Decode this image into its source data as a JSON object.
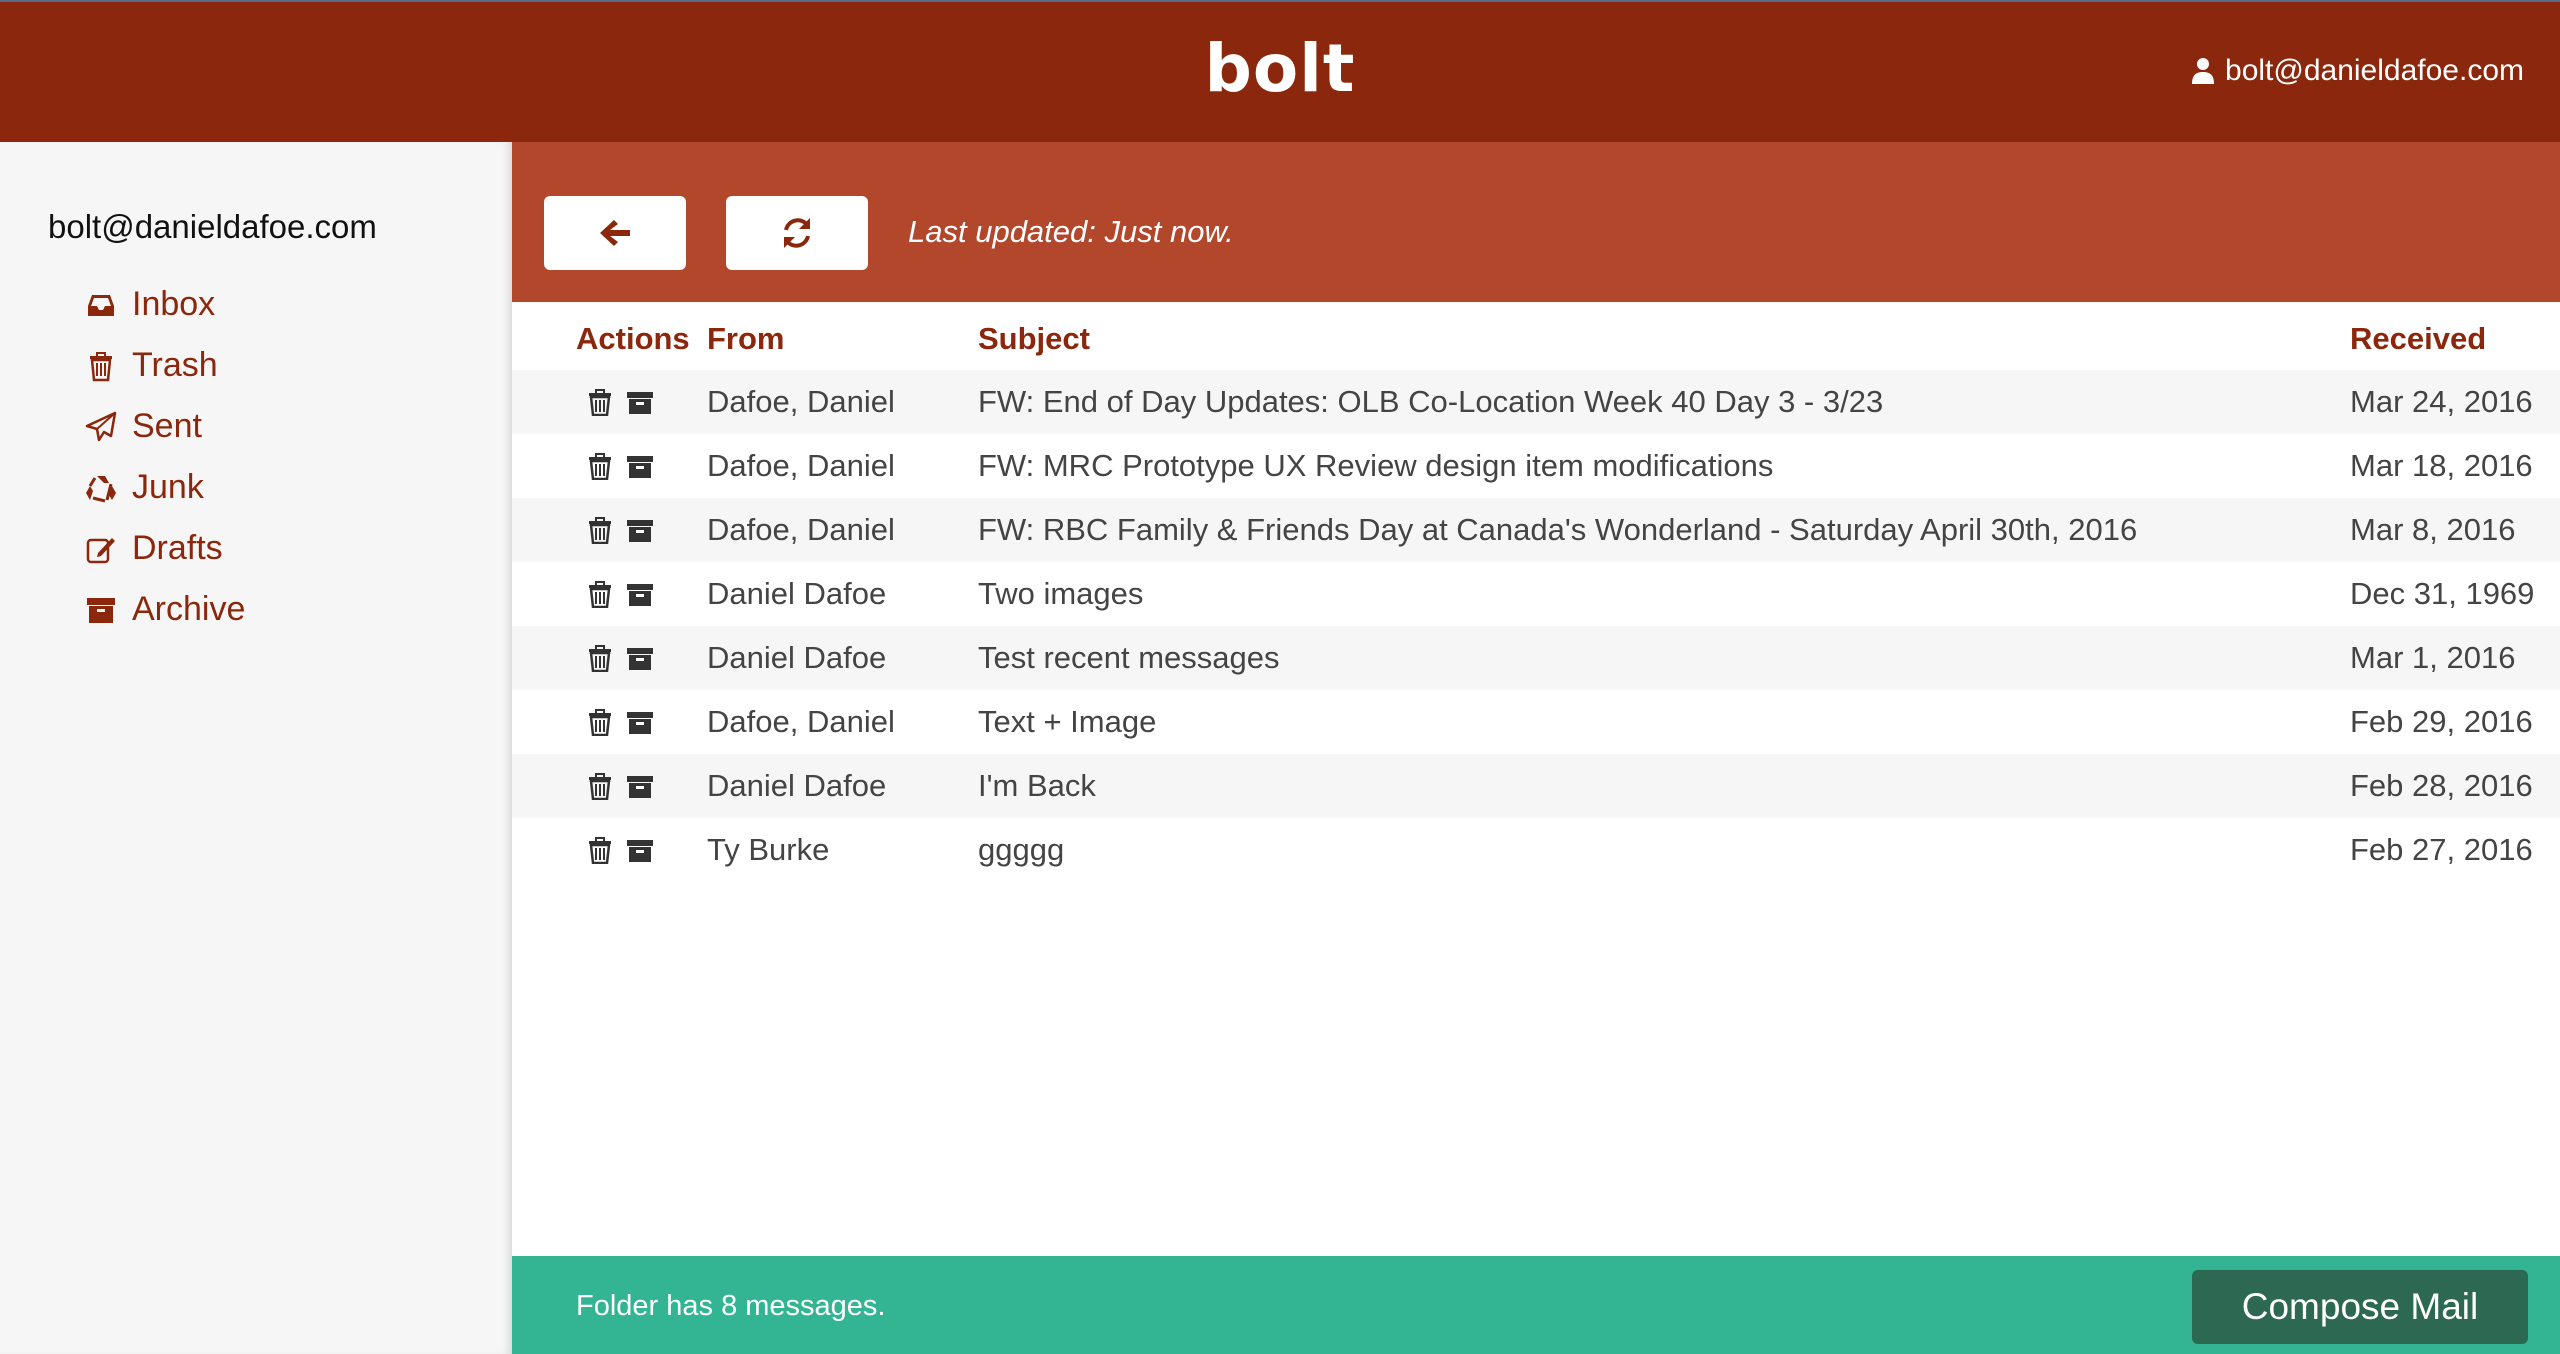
{
  "header": {
    "logo": "bolt",
    "user_email": "bolt@danieldafoe.com"
  },
  "sidebar": {
    "account": "bolt@danieldafoe.com",
    "folders": [
      {
        "label": "Inbox",
        "icon": "inbox-icon"
      },
      {
        "label": "Trash",
        "icon": "trash-icon"
      },
      {
        "label": "Sent",
        "icon": "paper-plane-icon"
      },
      {
        "label": "Junk",
        "icon": "recycle-icon"
      },
      {
        "label": "Drafts",
        "icon": "edit-icon"
      },
      {
        "label": "Archive",
        "icon": "archive-icon"
      }
    ]
  },
  "toolbar": {
    "back_icon": "arrow-left-icon",
    "refresh_icon": "refresh-icon",
    "last_updated": "Last updated: Just now."
  },
  "table": {
    "columns": [
      "Actions",
      "From",
      "Subject",
      "Received"
    ],
    "rows": [
      {
        "from": "Dafoe, Daniel",
        "subject": "FW: End of Day Updates: OLB Co-Location Week 40 Day 3 - 3/23",
        "received": "Mar 24, 2016"
      },
      {
        "from": "Dafoe, Daniel",
        "subject": "FW: MRC Prototype UX Review design item modifications",
        "received": "Mar 18, 2016"
      },
      {
        "from": "Dafoe, Daniel",
        "subject": "FW: RBC Family & Friends Day at Canada's Wonderland - Saturday April 30th, 2016",
        "received": "Mar 8, 2016"
      },
      {
        "from": "Daniel Dafoe",
        "subject": "Two images",
        "received": "Dec 31, 1969"
      },
      {
        "from": "Daniel Dafoe",
        "subject": "Test recent messages",
        "received": "Mar 1, 2016"
      },
      {
        "from": "Dafoe, Daniel",
        "subject": "Text + Image",
        "received": "Feb 29, 2016"
      },
      {
        "from": "Daniel Dafoe",
        "subject": "I'm Back",
        "received": "Feb 28, 2016"
      },
      {
        "from": "Ty Burke",
        "subject": "ggggg",
        "received": "Feb 27, 2016"
      }
    ]
  },
  "footer": {
    "count_text": "Folder has 8 messages.",
    "compose_label": "Compose Mail"
  },
  "colors": {
    "header": "#8a270c",
    "toolbar": "#b2472c",
    "accent_text": "#8a270c",
    "footer": "#33b492",
    "compose_button": "#2d6852"
  }
}
